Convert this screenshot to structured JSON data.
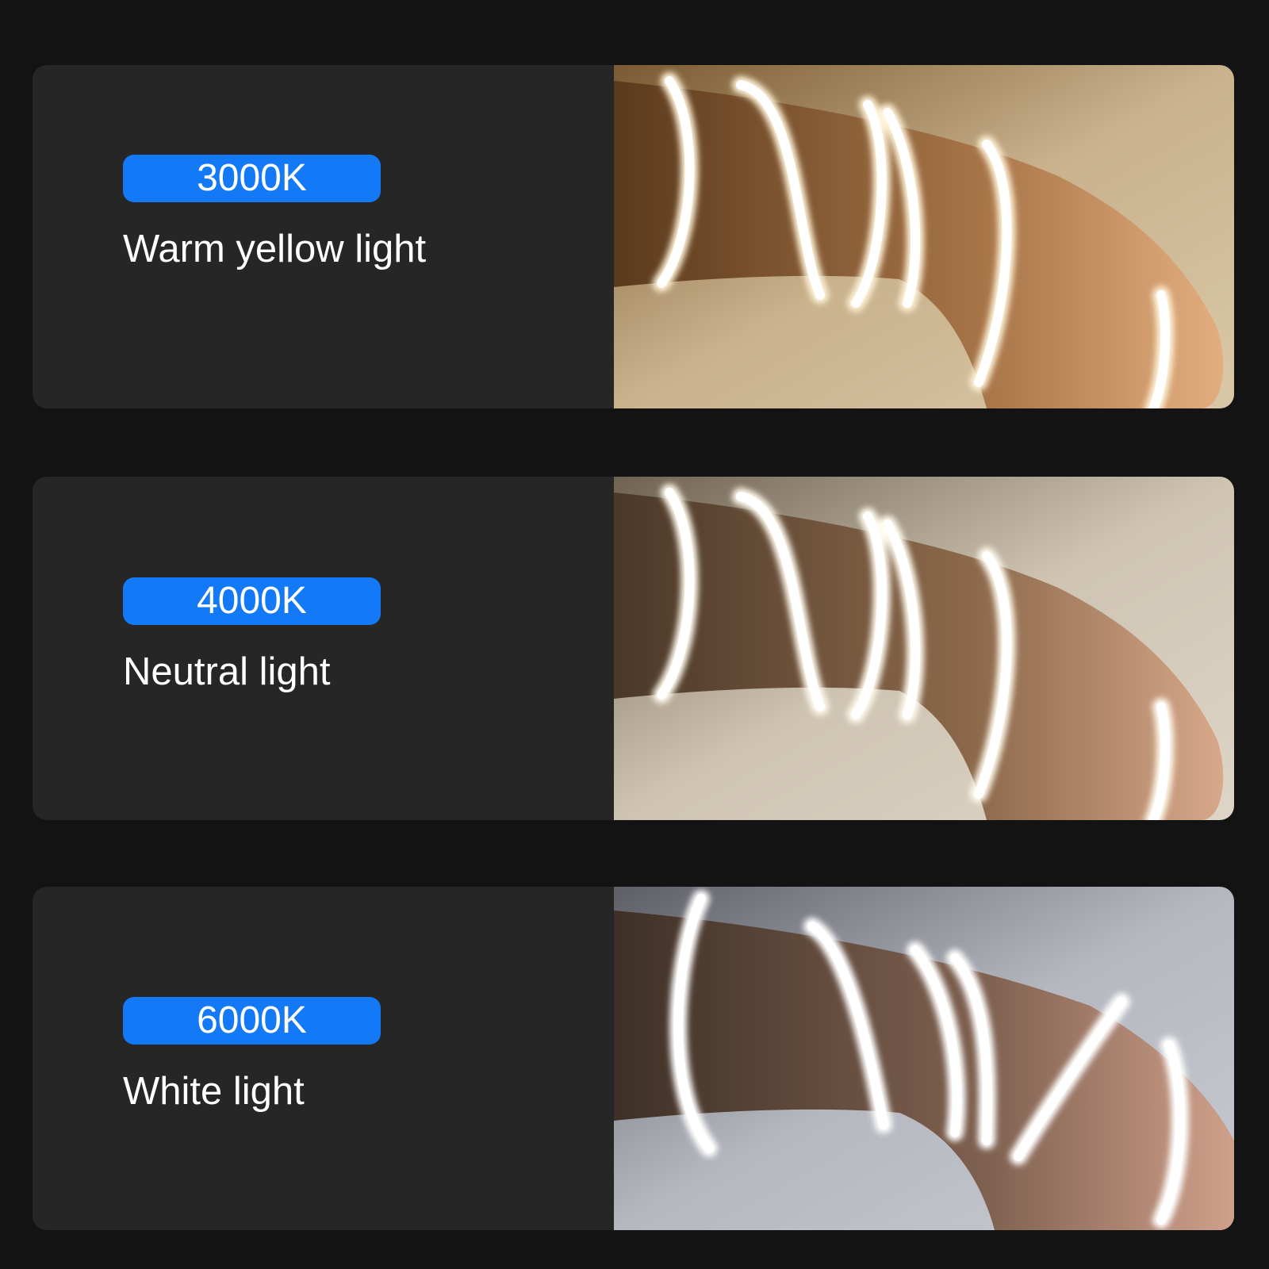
{
  "panels": [
    {
      "badge": "3000K",
      "label": "Warm yellow light",
      "badge_color": "#1479f6"
    },
    {
      "badge": "4000K",
      "label": "Neutral light",
      "badge_color": "#1479f6"
    },
    {
      "badge": "6000K",
      "label": "White light",
      "badge_color": "#1479f6"
    }
  ],
  "colors": {
    "background": "#131313",
    "card": "#262626",
    "badge": "#1479f6",
    "text": "#ffffff"
  }
}
